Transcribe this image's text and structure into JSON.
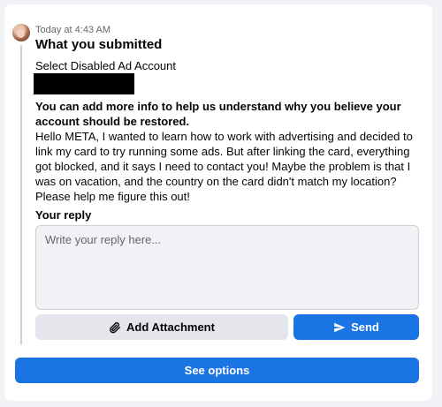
{
  "message": {
    "timestamp": "Today at 4:43 AM",
    "title": "What you submitted",
    "field_label": "Select Disabled Ad Account",
    "question": "You can add more info to help us understand why you believe your account should be restored.",
    "answer": "Hello META, I wanted to learn how to work with advertising and decided to link my card to try running some ads. But after linking the card, everything got blocked, and it says I need to contact you! Maybe the problem is that I was on vacation, and the country on the card didn't match my location? Please help me figure this out!"
  },
  "reply": {
    "label": "Your reply",
    "placeholder": "Write your reply here...",
    "value": ""
  },
  "buttons": {
    "add_attachment": "Add Attachment",
    "send": "Send",
    "see_options": "See options"
  },
  "icons": {
    "attachment": "paperclip-icon",
    "send": "paper-plane-icon"
  },
  "colors": {
    "primary": "#1b74e4",
    "secondary_button": "#e4e6eb",
    "input_bg": "#f0f2f5"
  }
}
